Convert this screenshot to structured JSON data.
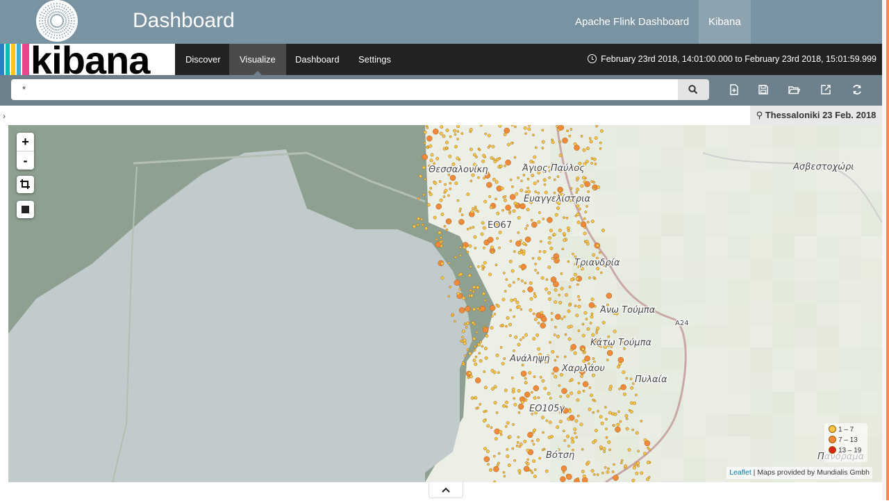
{
  "header": {
    "app_title": "Dashboard",
    "links": [
      {
        "label": "Apache Flink Dashboard"
      },
      {
        "label": "Kibana"
      }
    ]
  },
  "brand": {
    "logo_text": "kibana",
    "stripe_colors": [
      "#3caed2",
      "#e8488b",
      "#fec514",
      "#00bfb3"
    ]
  },
  "nav": {
    "items": [
      "Discover",
      "Visualize",
      "Dashboard",
      "Settings"
    ],
    "active": "Visualize",
    "time_range": "February 23rd 2018, 14:01:00.000 to February 23rd 2018, 15:01:59.999"
  },
  "search": {
    "query": "*"
  },
  "toolbar": {
    "icons": [
      "new-icon",
      "save-icon",
      "open-icon",
      "share-icon",
      "refresh-icon"
    ]
  },
  "visualization": {
    "title": "Thessaloniki 23 Feb. 2018",
    "map_labels": [
      "Θεσσαλονίκη",
      "Άγιος Παύλος",
      "Ευαγγελίστρια",
      "ΕΟ67",
      "Τριανδρία",
      "Άνω Τούμπα",
      "A24",
      "Κάτω Τούμπα",
      "Ανάληψη",
      "Χαριλάου",
      "Πυλαία",
      "ΕΟ105γ",
      "Βότση",
      "Ασβεστοχώρι",
      "Πανόραμα"
    ],
    "legend": [
      {
        "label": "1 – 7",
        "color": "#f7c846"
      },
      {
        "label": "7 – 13",
        "color": "#f08a3a"
      },
      {
        "label": "13 – 19",
        "color": "#d8231d"
      }
    ],
    "attribution_link": "Leaflet",
    "attribution_text": " | Maps provided by Mundialis Gmbh",
    "zoom_in": "+",
    "zoom_out": "-"
  },
  "colors": {
    "topbar": "#7a93a2",
    "navbar": "#222222",
    "searchbar": "#6d808c",
    "sea": "#c1cbcc",
    "land": "#8ea191"
  }
}
